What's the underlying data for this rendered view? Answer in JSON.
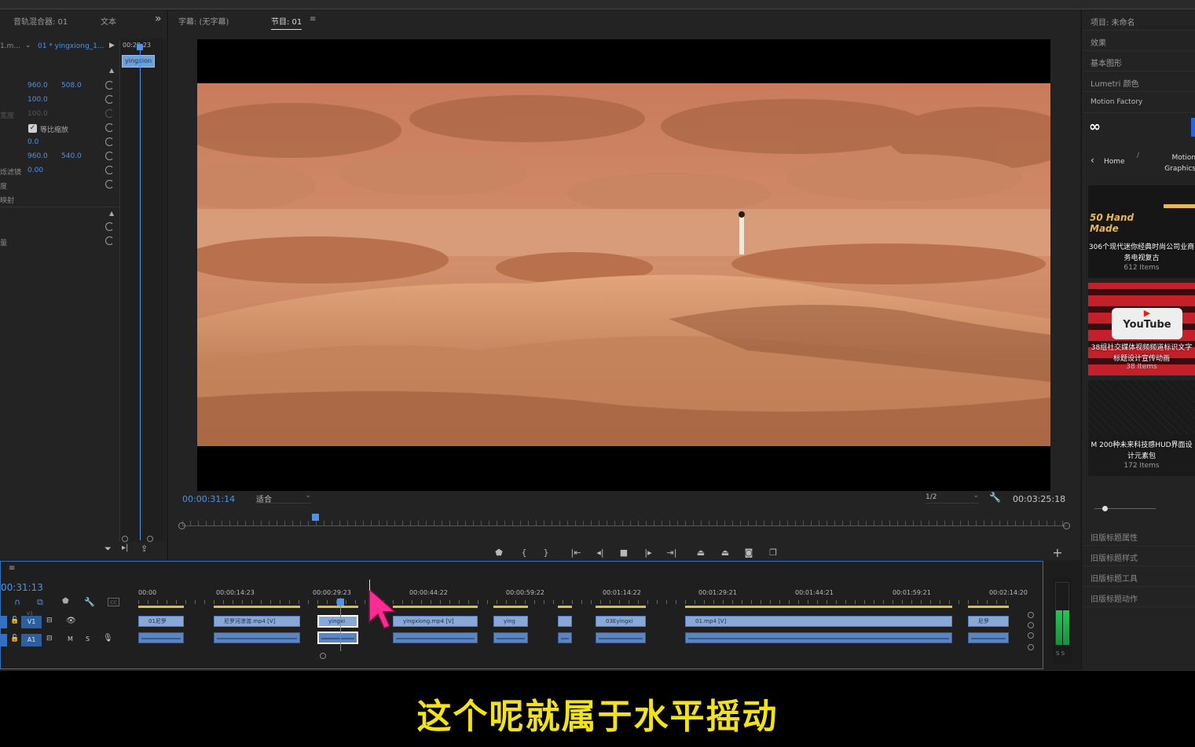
{
  "left_panel": {
    "tabs": [
      "音轨混合器: 01",
      "文本"
    ],
    "expand_icon": "»",
    "clip_path": "1.m...",
    "clip_name": "01 * yingxiong_1...",
    "timecode": "00:29:23",
    "clip_chip": "yingxion",
    "rows": [
      {
        "label": "",
        "v1": "",
        "v2": ""
      },
      {
        "label": "",
        "v1": "960.0",
        "v2": "508.0"
      },
      {
        "label": "",
        "v1": "100.0",
        "v2": ""
      },
      {
        "label": "宽度",
        "v1": "100.0",
        "v2": ""
      },
      {
        "label": "",
        "v1": "等比缩放",
        "v2": ""
      },
      {
        "label": "",
        "v1": "0.0",
        "v2": ""
      },
      {
        "label": "",
        "v1": "960.0",
        "v2": "540.0"
      },
      {
        "label": "烁滤镜",
        "v1": "0.00",
        "v2": ""
      },
      {
        "label": "度",
        "v1": "",
        "v2": ""
      },
      {
        "label": "映射",
        "v1": "",
        "v2": ""
      },
      {
        "label": "",
        "v1": "",
        "v2": ""
      },
      {
        "label": "",
        "v1": "",
        "v2": ""
      },
      {
        "label": "量",
        "v1": "",
        "v2": ""
      }
    ]
  },
  "monitor": {
    "tabs": [
      "字幕: (无字幕)",
      "节目: 01"
    ],
    "menu_icon": "≡",
    "current_time": "00:00:31:14",
    "fit_label": "适合",
    "resolution": "1/2",
    "duration": "00:03:25:18",
    "playhead_fraction": 0.15
  },
  "right_panel": {
    "items": [
      "项目: 未命名",
      "效果",
      "基本图形",
      "Lumetri 颜色",
      "Motion Factory"
    ],
    "nav": {
      "back": "‹",
      "home": "Home",
      "sep": "/",
      "crumb": "Motion Graphics Templates"
    },
    "cards": [
      {
        "title": "306个现代迷你经典时尚公司业商务电视复古",
        "items": "612 Items",
        "logo_text": "50 Hand Made"
      },
      {
        "title": "38组社交媒体视频频道标识文字标题设计宣传动画",
        "items": "38 Items",
        "logo_text": "YouTube"
      },
      {
        "title": "M 200种未来科技感HUD界面设计元素包",
        "items": "172 Items",
        "logo_text": ""
      }
    ],
    "lower_items": [
      "旧版标题属性",
      "旧版标题样式",
      "旧版标题工具",
      "旧版标题动作"
    ]
  },
  "timeline": {
    "menu_icon": "≡",
    "timecode": "00:31:13",
    "ruler": [
      "00:00",
      "00:00:14:23",
      "00:00:29:23",
      "00:00:44:22",
      "00:00:59:22",
      "00:01:14:22",
      "00:01:29:21",
      "00:01:44:21",
      "00:01:59:21",
      "00:02:14:20"
    ],
    "video_track": "V1",
    "audio_track": "A1",
    "track_codes": {
      "v_small": "V1",
      "m": "M",
      "s": "S"
    },
    "clips": [
      "01尼罗",
      "尼罗河渗渡.mp4 [V]",
      "yingxi",
      "yingxiong.mp4 [V]",
      "ying",
      "",
      "03Eyingxi",
      "01.mp4 [V]",
      "尼罗"
    ],
    "meter_labels": "S S"
  },
  "subtitle": "这个呢就属于水平摇动",
  "colors": {
    "accent": "#4f93e6",
    "panel": "#232323",
    "clip_video": "#88a8d8",
    "clip_audio": "#5c84bf",
    "subtitle": "#f2e21a",
    "cursor": "#ff2a92"
  }
}
